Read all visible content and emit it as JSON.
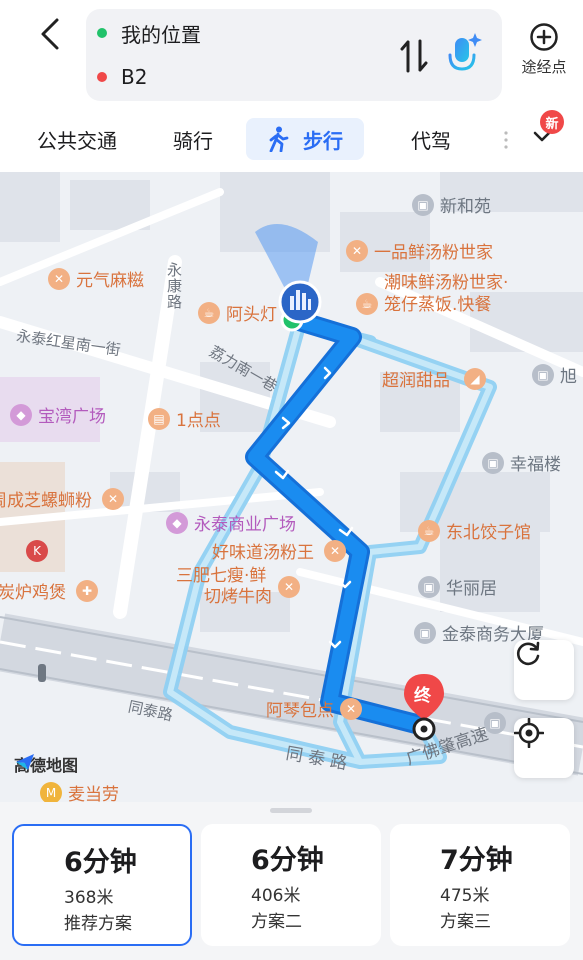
{
  "header": {
    "start": "我的位置",
    "end": "B2",
    "via_label": "途经点"
  },
  "tabs": [
    {
      "label": "公共交通"
    },
    {
      "label": "骑行"
    },
    {
      "label": "步行"
    },
    {
      "label": "代驾"
    }
  ],
  "badge": "新",
  "map": {
    "pois": {
      "xinhe": "新和苑",
      "yipin": "一品鲜汤粉世家",
      "chaowei1": "潮味鲜汤粉世家·",
      "chaowei2": "笼仔蒸饭.快餐",
      "yuanqi": "元气麻糍",
      "atou": "阿头灯",
      "chaorun": "超润甜品",
      "xu": "旭",
      "baowan": "宝湾广场",
      "yidian": "1点点",
      "xingfu": "幸福楼",
      "zhouchengzhi": "周成芝螺蛳粉",
      "yongtai": "永泰商业广场",
      "dongbei": "东北饺子馆",
      "haowei": "好味道汤粉王",
      "sanfei1": "三肥七瘦·鲜",
      "sanfei2": "切烤牛肉",
      "huali": "华丽居",
      "tanlu": "炭炉鸡煲",
      "jintai": "金泰商务大厦",
      "aqin": "阿琴包点",
      "mcd": "麦当劳"
    },
    "roads": {
      "yongkang": "永康路",
      "yongtai_hongxing": "永泰红星南一街",
      "lichun": "荔力南一巷",
      "tongtai1": "同泰路",
      "tongtai2": "同 泰 路",
      "guangfo": "广佛肇高速"
    },
    "end_marker": "终",
    "watermark": "高德地图"
  },
  "plans": [
    {
      "time": "6分钟",
      "distance": "368米",
      "name": "推荐方案"
    },
    {
      "time": "6分钟",
      "distance": "406米",
      "name": "方案二"
    },
    {
      "time": "7分钟",
      "distance": "475米",
      "name": "方案三"
    }
  ],
  "colors": {
    "accent": "#2a6df4",
    "route_main": "#1a8cf0",
    "route_alt": "#8fd0f2",
    "end_red": "#f04848",
    "start_green": "#21c26a"
  }
}
